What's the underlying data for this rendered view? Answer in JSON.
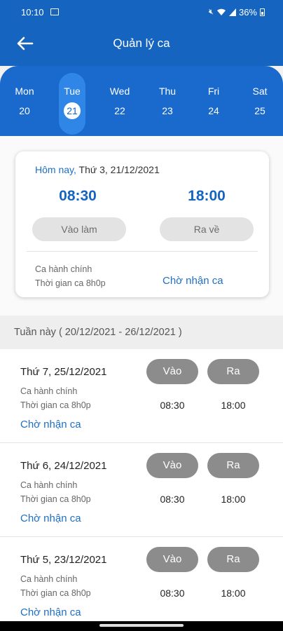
{
  "status_bar": {
    "time": "10:10",
    "battery": "36%"
  },
  "app_bar": {
    "title": "Quản lý ca"
  },
  "week": {
    "days": [
      {
        "name": "Mon",
        "date": "20"
      },
      {
        "name": "Tue",
        "date": "21",
        "selected": true
      },
      {
        "name": "Wed",
        "date": "22"
      },
      {
        "name": "Thu",
        "date": "23"
      },
      {
        "name": "Fri",
        "date": "24"
      },
      {
        "name": "Sat",
        "date": "25"
      }
    ]
  },
  "today_card": {
    "today_label": "Hôm nay,",
    "date": " Thứ 3, 21/12/2021",
    "start_time": "08:30",
    "end_time": "18:00",
    "checkin_label": "Vào làm",
    "checkout_label": "Ra về",
    "shift_name": "Ca hành chính",
    "shift_duration": "Thời gian ca 8h0p",
    "status": "Chờ nhận ca"
  },
  "section": {
    "title": "Tuần này ( 20/12/2021 - 26/12/2021 )"
  },
  "shifts": [
    {
      "date": "Thứ 7, 25/12/2021",
      "name": "Ca hành chính",
      "duration": "Thời gian ca 8h0p",
      "status": "Chờ nhận ca",
      "in_label": "Vào",
      "out_label": "Ra",
      "in_time": "08:30",
      "out_time": "18:00"
    },
    {
      "date": "Thứ 6, 24/12/2021",
      "name": "Ca hành chính",
      "duration": "Thời gian ca 8h0p",
      "status": "Chờ nhận ca",
      "in_label": "Vào",
      "out_label": "Ra",
      "in_time": "08:30",
      "out_time": "18:00"
    },
    {
      "date": "Thứ 5, 23/12/2021",
      "name": "Ca hành chính",
      "duration": "Thời gian ca 8h0p",
      "status": "Chờ nhận ca",
      "in_label": "Vào",
      "out_label": "Ra",
      "in_time": "08:30",
      "out_time": "18:00"
    }
  ],
  "colors": {
    "primary": "#1565c0",
    "accent_text": "#1e6fc4",
    "button_dark": "#8c8c8c",
    "button_light": "#e3e3e3"
  }
}
